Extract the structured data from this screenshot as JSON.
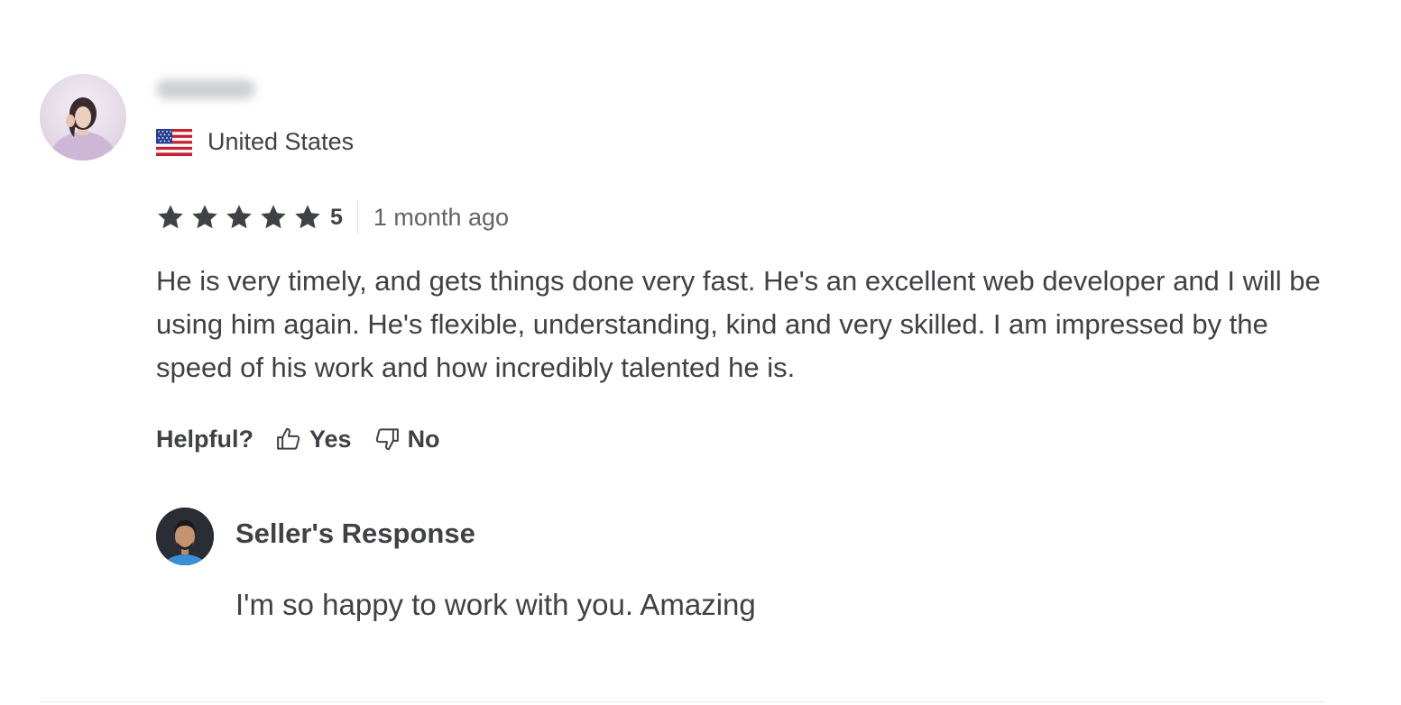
{
  "reviewer": {
    "name": "",
    "country": "United States",
    "flag_icon": "us-flag-icon",
    "avatar_icon": "reviewer-avatar"
  },
  "rating": {
    "stars": 5,
    "value": "5",
    "time": "1 month ago",
    "star_color": "#404145"
  },
  "review": {
    "text": "He is very timely, and gets things done very fast. He's an excellent web developer and I will be using him again. He's flexible, understanding, kind and very skilled. I am impressed by the speed of his work and how incredibly talented he is."
  },
  "helpful": {
    "label": "Helpful?",
    "yes": "Yes",
    "no": "No"
  },
  "seller_response": {
    "title": "Seller's Response",
    "text": "I'm so happy to work with you. Amazing"
  }
}
